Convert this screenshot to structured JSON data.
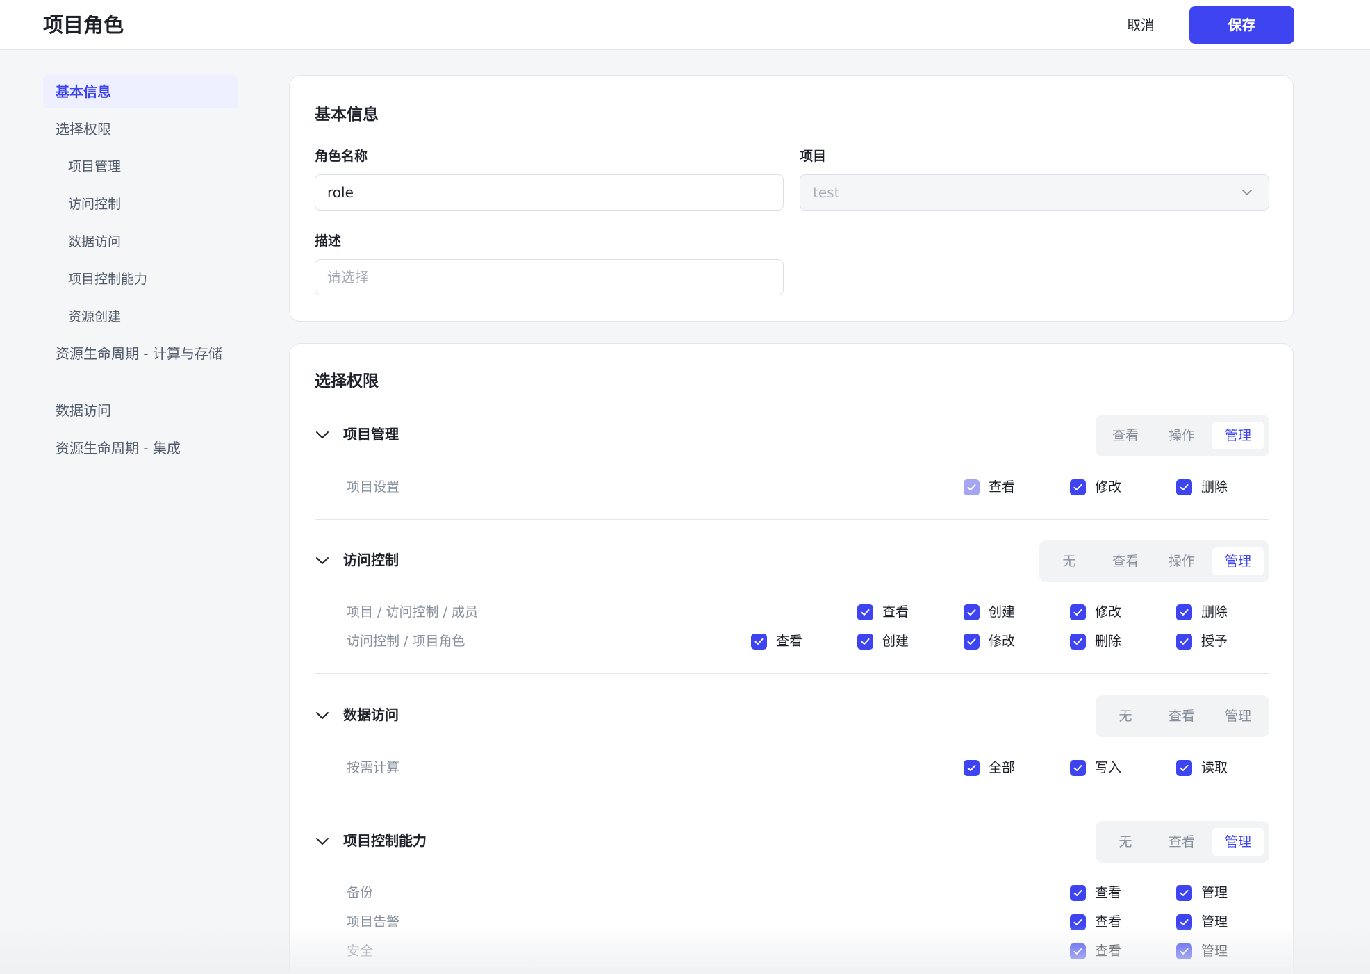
{
  "header": {
    "title": "项目角色",
    "cancel_label": "取消",
    "save_label": "保存"
  },
  "sidebar": {
    "items": [
      {
        "label": "基本信息",
        "active": true
      },
      {
        "label": "选择权限"
      },
      {
        "label": "项目管理"
      },
      {
        "label": "访问控制"
      },
      {
        "label": "数据访问"
      },
      {
        "label": "项目控制能力"
      },
      {
        "label": "资源创建"
      },
      {
        "label": "资源生命周期 - 计算与存储"
      },
      {
        "label": "数据访问"
      },
      {
        "label": "资源生命周期 - 集成"
      }
    ]
  },
  "basic_info": {
    "title": "基本信息",
    "role_name_label": "角色名称",
    "role_name_value": "role",
    "project_label": "项目",
    "project_value": "test",
    "desc_label": "描述",
    "desc_placeholder": "请选择"
  },
  "permissions": {
    "title": "选择权限",
    "groups": [
      {
        "title": "项目管理",
        "options": [
          "查看",
          "操作",
          "管理"
        ],
        "selected": "管理",
        "rows": [
          {
            "label": "项目设置",
            "checks": [
              "查看",
              "修改",
              "删除"
            ]
          }
        ]
      },
      {
        "title": "访问控制",
        "options": [
          "无",
          "查看",
          "操作",
          "管理"
        ],
        "selected": "管理",
        "rows": [
          {
            "label": "项目 / 访问控制 / 成员",
            "checks": [
              "查看",
              "创建",
              "修改",
              "删除"
            ]
          },
          {
            "label": "访问控制 / 项目角色",
            "checks": [
              "查看",
              "创建",
              "修改",
              "删除",
              "授予"
            ]
          }
        ]
      },
      {
        "title": "数据访问",
        "options": [
          "无",
          "查看",
          "管理"
        ],
        "selected": "",
        "rows": [
          {
            "label": "按需计算",
            "checks": [
              "全部",
              "写入",
              "读取"
            ]
          }
        ]
      },
      {
        "title": "项目控制能力",
        "options": [
          "无",
          "查看",
          "管理"
        ],
        "selected": "管理",
        "rows": [
          {
            "label": "备份",
            "checks": [
              "查看",
              "管理"
            ]
          },
          {
            "label": "项目告警",
            "checks": [
              "查看",
              "管理"
            ]
          },
          {
            "label": "安全",
            "checks": [
              "查看",
              "管理"
            ]
          }
        ]
      }
    ]
  },
  "colors": {
    "accent": "#3d44f0",
    "accent_light": "#a4a6f4",
    "muted_text": "#86909c",
    "page_bg": "#f5f6f8"
  }
}
